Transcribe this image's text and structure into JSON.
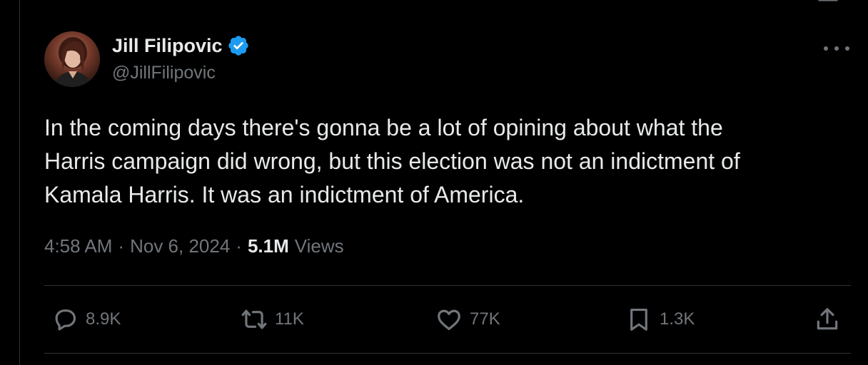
{
  "author": {
    "name": "Jill Filipovic",
    "handle": "@JillFilipovic",
    "verified": true
  },
  "tweet": {
    "text": "In the coming days there's gonna be a lot of opining about what the\nHarris campaign did wrong, but this election was not an indictment of\nKamala Harris. It was an indictment of America."
  },
  "meta": {
    "time": "4:58 AM",
    "separator": "·",
    "date": "Nov 6, 2024",
    "views_count": "5.1M",
    "views_label": "Views"
  },
  "actions": {
    "reply_count": "8.9K",
    "repost_count": "11K",
    "like_count": "77K",
    "bookmark_count": "1.3K"
  },
  "colors": {
    "background": "#000000",
    "text_primary": "#e7e9ea",
    "text_secondary": "#71767b",
    "verified_blue": "#1d9bf0",
    "divider": "#2f3336"
  },
  "icons": {
    "verified": "verified-badge-icon",
    "more": "more-horizontal-icon",
    "reply": "reply-bubble-icon",
    "repost": "repost-arrows-icon",
    "like": "heart-icon",
    "bookmark": "bookmark-icon",
    "share": "share-upload-icon"
  }
}
